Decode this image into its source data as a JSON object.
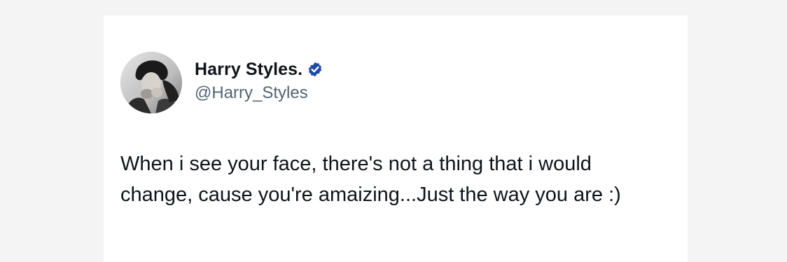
{
  "tweet": {
    "author": {
      "display_name": "Harry Styles.",
      "handle": "@Harry_Styles",
      "verified": true,
      "verified_icon": "verified-badge-icon",
      "verified_color": "#1d4aa8",
      "avatar_desc": "avatar"
    },
    "text": "When i see your face, there's not a thing that i would change, cause you're amaizing...Just the way you are :)"
  },
  "colors": {
    "background": "#f4f4f4",
    "card": "#ffffff",
    "primary_text": "#0f1419",
    "secondary_text": "#536471"
  }
}
